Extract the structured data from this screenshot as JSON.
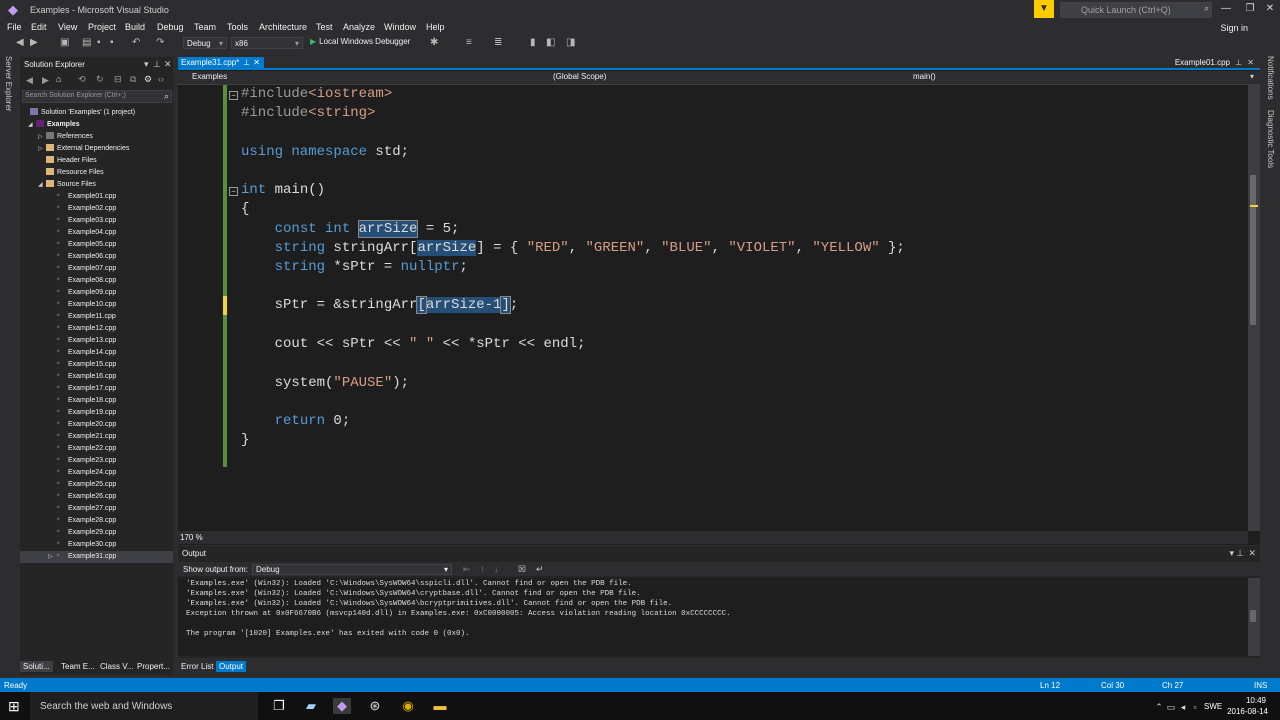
{
  "window": {
    "title": "Examples - Microsoft Visual Studio",
    "quick_launch_placeholder": "Quick Launch (Ctrl+Q)",
    "sign_in": "Sign in"
  },
  "menu": [
    "File",
    "Edit",
    "View",
    "Project",
    "Build",
    "Debug",
    "Team",
    "Tools",
    "Architecture",
    "Test",
    "Analyze",
    "Window",
    "Help"
  ],
  "toolbar": {
    "config": "Debug",
    "platform": "x86",
    "launch": "Local Windows Debugger"
  },
  "left_strip": [
    "Server Explorer"
  ],
  "solution_explorer": {
    "title": "Solution Explorer",
    "search_placeholder": "Search Solution Explorer (Ctrl+;)",
    "tree": [
      {
        "label": "Solution 'Examples' (1 project)",
        "indent": 0,
        "type": "solution"
      },
      {
        "label": "Examples",
        "indent": 1,
        "type": "project"
      },
      {
        "label": "References",
        "indent": 2,
        "type": "folder"
      },
      {
        "label": "External Dependencies",
        "indent": 2,
        "type": "folder"
      },
      {
        "label": "Header Files",
        "indent": 2,
        "type": "folder"
      },
      {
        "label": "Resource Files",
        "indent": 2,
        "type": "folder"
      },
      {
        "label": "Source Files",
        "indent": 2,
        "type": "folder"
      }
    ],
    "files": [
      "Example01.cpp",
      "Example02.cpp",
      "Example03.cpp",
      "Example04.cpp",
      "Example05.cpp",
      "Example06.cpp",
      "Example07.cpp",
      "Example08.cpp",
      "Example09.cpp",
      "Example10.cpp",
      "Example11.cpp",
      "Example12.cpp",
      "Example13.cpp",
      "Example14.cpp",
      "Example15.cpp",
      "Example16.cpp",
      "Example17.cpp",
      "Example18.cpp",
      "Example19.cpp",
      "Example20.cpp",
      "Example21.cpp",
      "Example22.cpp",
      "Example23.cpp",
      "Example24.cpp",
      "Example25.cpp",
      "Example26.cpp",
      "Example27.cpp",
      "Example28.cpp",
      "Example29.cpp",
      "Example30.cpp",
      "Example31.cpp"
    ],
    "selected_file": "Example31.cpp"
  },
  "editor": {
    "active_tab": "Example31.cpp*",
    "right_tab": "Example01.cpp",
    "nav": {
      "project": "Examples",
      "scope": "(Global Scope)",
      "member": "main()"
    },
    "zoom": "170 %"
  },
  "right_strip": [
    "Notifications",
    "Diagnostic Tools"
  ],
  "output": {
    "title": "Output",
    "show_label": "Show output from:",
    "source": "Debug",
    "lines": [
      "'Examples.exe' (Win32): Loaded 'C:\\Windows\\SysWOW64\\sspicli.dll'. Cannot find or open the PDB file.",
      "'Examples.exe' (Win32): Loaded 'C:\\Windows\\SysWOW64\\cryptbase.dll'. Cannot find or open the PDB file.",
      "'Examples.exe' (Win32): Loaded 'C:\\Windows\\SysWOW64\\bcryptprimitives.dll'. Cannot find or open the PDB file.",
      "Exception thrown at 0x0F6670B6 (msvcp140d.dll) in Examples.exe: 0xC0000005: Access violation reading location 0xCCCCCCCC.",
      "",
      "The program '[1020] Examples.exe' has exited with code 0 (0x0)."
    ]
  },
  "bottom_tabs": [
    "Soluti...",
    "Team E...",
    "Class V...",
    "Propert...",
    "Error List",
    "Output"
  ],
  "status": {
    "ready": "Ready",
    "line": "Ln 12",
    "col": "Col 30",
    "ch": "Ch 27",
    "mode": "INS"
  },
  "taskbar": {
    "search": "Search the web and Windows",
    "lang": "SWE",
    "time": "10:49",
    "date": "2016-08-14"
  },
  "colors": {
    "accent": "#007acc",
    "background": "#2d2d30",
    "editor": "#1e1e1e",
    "keyword": "#569cd6",
    "string": "#d69d85"
  }
}
